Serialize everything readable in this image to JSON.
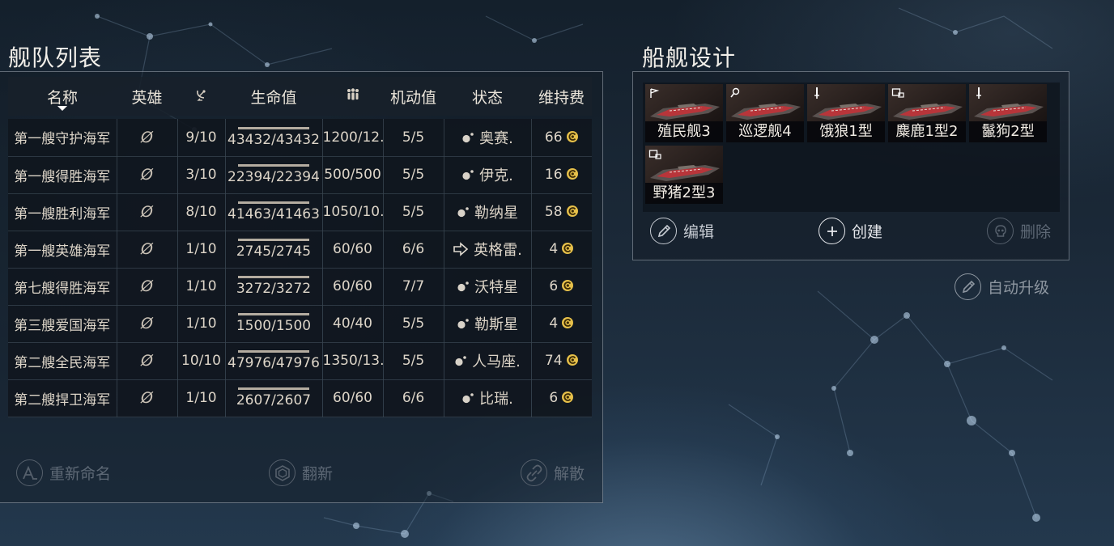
{
  "fleet": {
    "title": "舰队列表",
    "columns": [
      {
        "key": "name",
        "label": "名称",
        "icon": null
      },
      {
        "key": "hero",
        "label": "英雄",
        "icon": null
      },
      {
        "key": "range",
        "label": "",
        "icon": "radar-dish-icon"
      },
      {
        "key": "hp",
        "label": "生命值",
        "icon": null
      },
      {
        "key": "crew",
        "label": "",
        "icon": "crew-people-icon"
      },
      {
        "key": "mobility",
        "label": "机动值",
        "icon": null
      },
      {
        "key": "status",
        "label": "状态",
        "icon": null
      },
      {
        "key": "upkeep",
        "label": "维持费",
        "icon": null
      }
    ],
    "rows": [
      {
        "name": "第一艘守护海军",
        "hero": "Ø",
        "range": "9/10",
        "hp": "43432/43432",
        "hp_fraction": 1.0,
        "crew": "1200/12.",
        "mobility": "5/5",
        "status_icon": "orbit-icon",
        "status": "奥赛.",
        "upkeep": "66"
      },
      {
        "name": "第一艘得胜海军",
        "hero": "Ø",
        "range": "3/10",
        "hp": "22394/22394",
        "hp_fraction": 1.0,
        "crew": "500/500",
        "mobility": "5/5",
        "status_icon": "orbit-icon",
        "status": "伊克.",
        "upkeep": "16"
      },
      {
        "name": "第一艘胜利海军",
        "hero": "Ø",
        "range": "8/10",
        "hp": "41463/41463",
        "hp_fraction": 1.0,
        "crew": "1050/10.",
        "mobility": "5/5",
        "status_icon": "orbit-icon",
        "status": "勒纳星",
        "upkeep": "58"
      },
      {
        "name": "第一艘英雄海军",
        "hero": "Ø",
        "range": "1/10",
        "hp": "2745/2745",
        "hp_fraction": 1.0,
        "crew": "60/60",
        "mobility": "6/6",
        "status_icon": "move-arrow-icon",
        "status": "英格雷.",
        "upkeep": "4"
      },
      {
        "name": "第七艘得胜海军",
        "hero": "Ø",
        "range": "1/10",
        "hp": "3272/3272",
        "hp_fraction": 1.0,
        "crew": "60/60",
        "mobility": "7/7",
        "status_icon": "orbit-icon",
        "status": "沃特星",
        "upkeep": "6"
      },
      {
        "name": "第三艘爱国海军",
        "hero": "Ø",
        "range": "1/10",
        "hp": "1500/1500",
        "hp_fraction": 1.0,
        "crew": "40/40",
        "mobility": "5/5",
        "status_icon": "orbit-icon",
        "status": "勒斯星",
        "upkeep": "4"
      },
      {
        "name": "第二艘全民海军",
        "hero": "Ø",
        "range": "10/10",
        "hp": "47976/47976",
        "hp_fraction": 1.0,
        "crew": "1350/13.",
        "mobility": "5/5",
        "status_icon": "orbit-icon",
        "status": "人马座.",
        "upkeep": "74"
      },
      {
        "name": "第二艘捍卫海军",
        "hero": "Ø",
        "range": "1/10",
        "hp": "2607/2607",
        "hp_fraction": 1.0,
        "crew": "60/60",
        "mobility": "6/6",
        "status_icon": "orbit-icon",
        "status": "比瑞.",
        "upkeep": "6"
      }
    ],
    "actions": {
      "rename": "重新命名",
      "refit": "翻新",
      "disband": "解散"
    }
  },
  "design": {
    "title": "船舰设计",
    "ships": [
      {
        "label": "殖民舰3",
        "icon": "flag-icon"
      },
      {
        "label": "巡逻舰4",
        "icon": "magnifier-icon"
      },
      {
        "label": "饿狼1型",
        "icon": "sword-icon"
      },
      {
        "label": "麋鹿1型2",
        "icon": "cargo-icon"
      },
      {
        "label": "鬣狗2型",
        "icon": "sword-icon"
      },
      {
        "label": "野猪2型3",
        "icon": "cargo-icon"
      }
    ],
    "actions": {
      "edit": "编辑",
      "create": "创建",
      "delete": "删除",
      "auto_upgrade": "自动升级"
    }
  },
  "colors": {
    "coin": "#e6c04a",
    "panel_border": "#bec8d2",
    "disabled_text": "#5d6875",
    "enabled_text": "#c6cbd2"
  }
}
